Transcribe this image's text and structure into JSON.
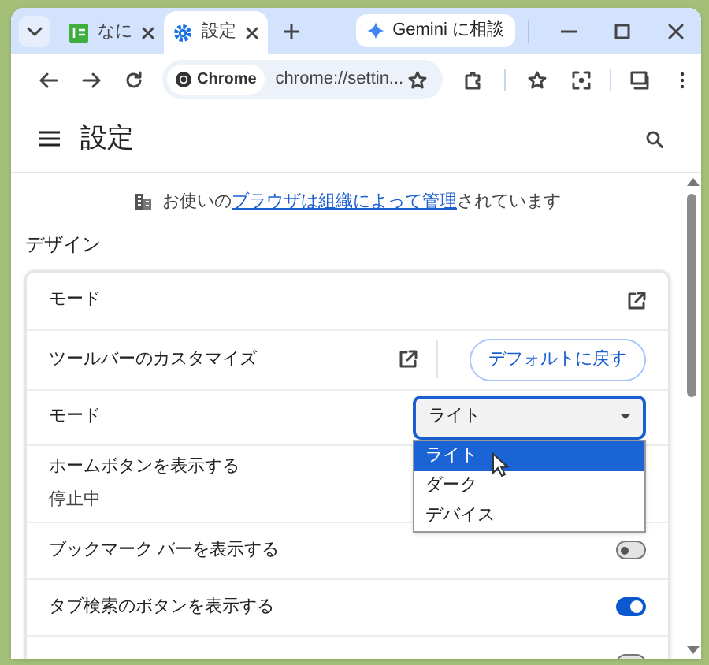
{
  "tab_strip": {
    "tabs": [
      {
        "title": "なに",
        "selected": false,
        "kind": "app"
      },
      {
        "title": "設定",
        "selected": true,
        "kind": "gear"
      }
    ],
    "gemini_button": "Gemini に相談"
  },
  "toolbar": {
    "chip": "Chrome",
    "url": "chrome://settin..."
  },
  "header": {
    "title": "設定"
  },
  "managed_notice": {
    "before": "お使いの",
    "link": "ブラウザは組織によって管理",
    "after": "されています"
  },
  "section_title": "デザイン",
  "rows": [
    {
      "kind": "link",
      "label": "モード"
    },
    {
      "kind": "link_reset",
      "label": "ツールバーのカスタマイズ",
      "button": "デフォルトに戻す"
    },
    {
      "kind": "select",
      "label": "モード",
      "value": "ライト",
      "expanded": true,
      "options": [
        {
          "label": "ライト",
          "selected": true
        },
        {
          "label": "ダーク",
          "selected": false
        },
        {
          "label": "デバイス",
          "selected": false
        }
      ]
    },
    {
      "kind": "text",
      "label": "ホームボタンを表示する",
      "sublabel": "停止中"
    },
    {
      "kind": "toggle",
      "label": "ブックマーク バーを表示する",
      "on": false
    },
    {
      "kind": "toggle",
      "label": "タブ検索のボタンを表示する",
      "on": true
    },
    {
      "kind": "toggle",
      "on": false
    }
  ]
}
